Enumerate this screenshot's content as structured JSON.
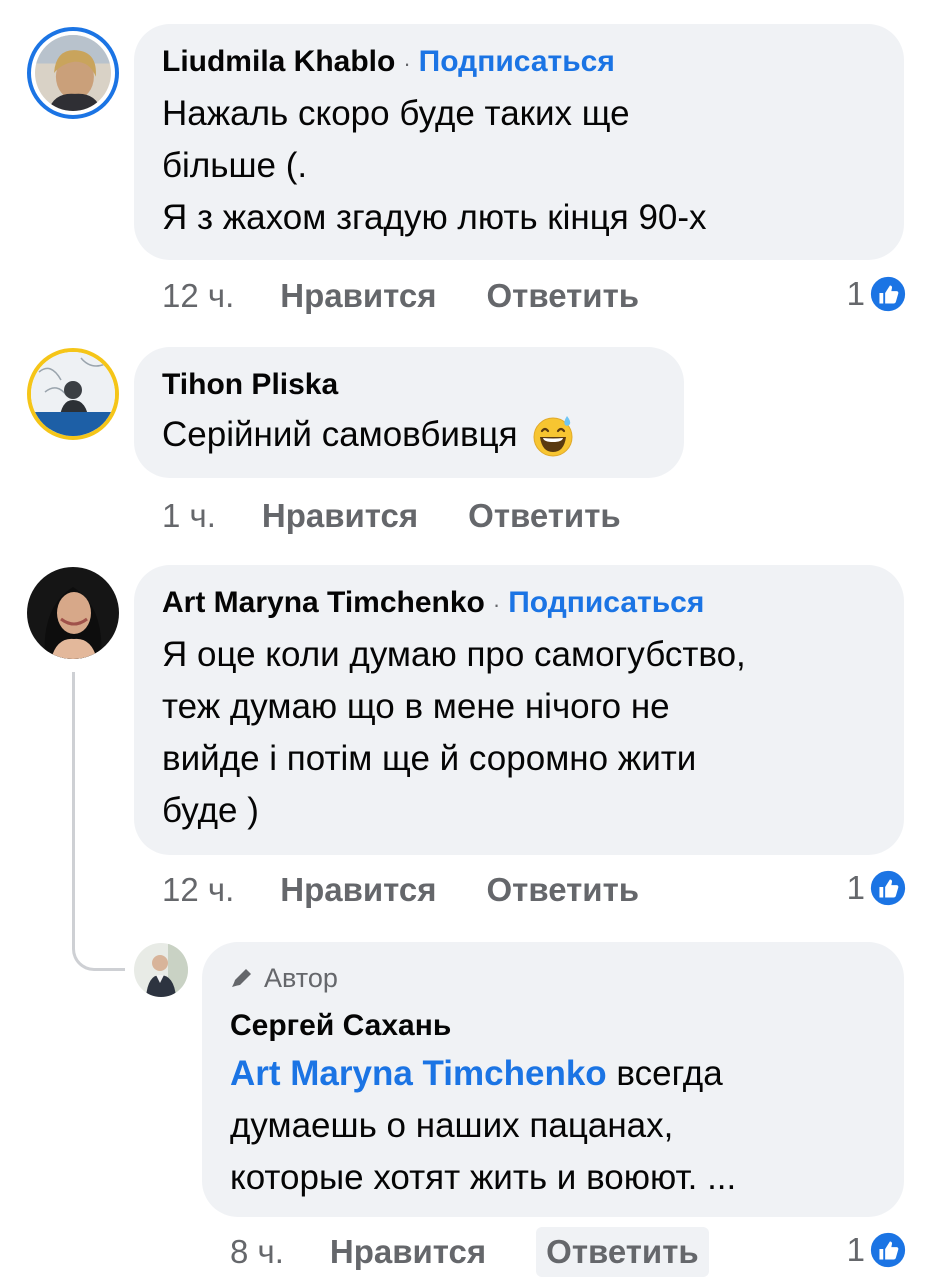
{
  "comments": [
    {
      "name": "Liudmila Khablo",
      "separator": "·",
      "follow": "Подписаться",
      "lines": [
        "Нажаль скоро буде таких ще",
        "більше (.",
        "Я з жахом згадую лють кінця 90-х"
      ],
      "time": "12 ч.",
      "like": "Нравится",
      "reply": "Ответить",
      "reactions": "1"
    },
    {
      "name": "Tihon Pliska",
      "text": "Серійний самовбивця",
      "emoji": "grinning-sweat-emoji",
      "time": "1 ч.",
      "like": "Нравится",
      "reply": "Ответить"
    },
    {
      "name": "Art Maryna Timchenko",
      "separator": "·",
      "follow": "Подписаться",
      "lines": [
        "Я оце коли думаю про самогубство,",
        "теж думаю що в мене нічого не",
        "вийде і потім ще й соромно жити",
        "буде )"
      ],
      "time": "12 ч.",
      "like": "Нравится",
      "reply": "Ответить",
      "reactions": "1"
    }
  ],
  "reply": {
    "author_badge": "Автор",
    "name": "Сергей Сахань",
    "mention": "Art Maryna Timchenko",
    "line1_rest": " всегда",
    "lines": [
      "думаешь о наших пацанах,",
      "которые хотят жить и воюют. ..."
    ],
    "time": "8 ч.",
    "like": "Нравится",
    "reply": "Ответить",
    "reactions": "1"
  },
  "icons": {
    "like_reaction": "like-icon",
    "author_pencil": "pencil-icon"
  },
  "colors": {
    "link_blue": "#1b74e4",
    "bubble_bg": "#f0f2f5",
    "meta_gray": "#65676b"
  }
}
